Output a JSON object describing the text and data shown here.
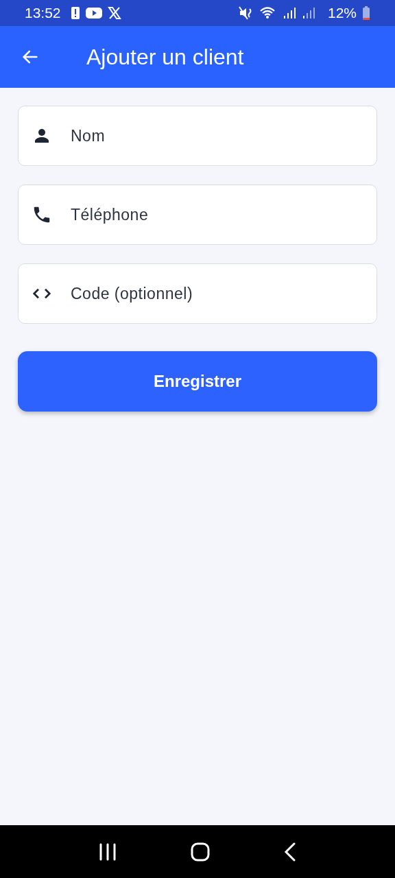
{
  "status_bar": {
    "time": "13:52",
    "battery": "12%"
  },
  "app_bar": {
    "title": "Ajouter un client"
  },
  "fields": [
    {
      "kind": "person",
      "placeholder": "Nom"
    },
    {
      "kind": "phone",
      "placeholder": "Téléphone"
    },
    {
      "kind": "code",
      "placeholder": "Code (optionnel)"
    }
  ],
  "save_button": {
    "label": "Enregistrer"
  }
}
